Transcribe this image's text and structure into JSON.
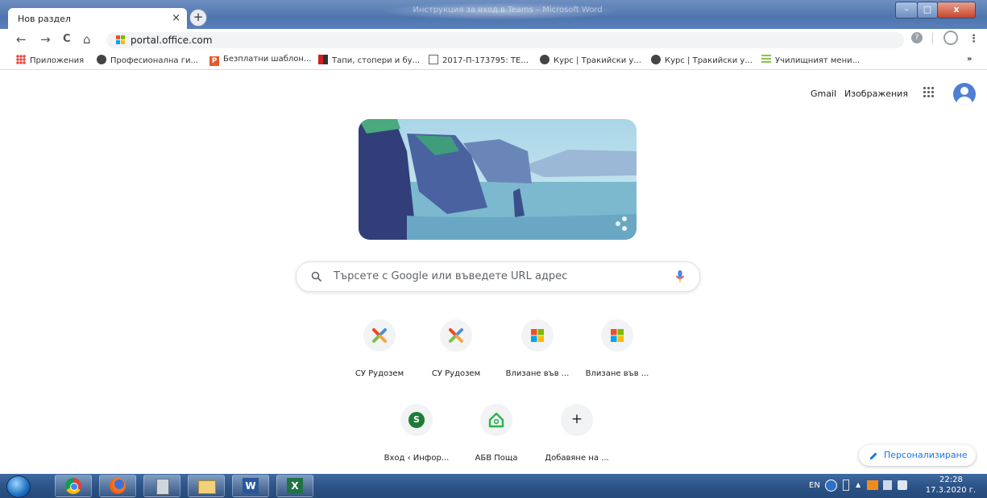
{
  "window": {
    "title": "Инструкция за вход в Teams – Microsoft Word"
  },
  "tab": {
    "title": "Нов раздел",
    "close_glyph": "×",
    "new_tab_glyph": "+"
  },
  "window_controls": {
    "minimize": "–",
    "maximize": "□",
    "close": "x"
  },
  "toolbar": {
    "back_glyph": "←",
    "forward_glyph": "→",
    "reload_glyph": "C",
    "home_glyph": "⌂",
    "url": "portal.office.com",
    "menu_glyph": "⋮"
  },
  "bookmarks": [
    {
      "label": "Приложения",
      "icon": "apps-icon"
    },
    {
      "label": "Професионална ги...",
      "icon": "globe-icon"
    },
    {
      "label": "Безплатни шаблон...",
      "icon": "p-icon"
    },
    {
      "label": "Тапи, стопери и бу...",
      "icon": "bar-icon"
    },
    {
      "label": "2017-П-173795: ТЕ...",
      "icon": "doc-icon"
    },
    {
      "label": "Курс | Тракийски у...",
      "icon": "globe-icon"
    },
    {
      "label": "Курс | Тракийски у...",
      "icon": "globe-icon"
    },
    {
      "label": "Училищният мени...",
      "icon": "lines-icon"
    }
  ],
  "bookmarks_more": "»",
  "top_links": {
    "gmail": "Gmail",
    "images": "Изображения"
  },
  "search": {
    "placeholder": "Търсете с Google или въведете URL адрес"
  },
  "shortcuts_row1": [
    {
      "label": "СУ Рудозем",
      "icon": "joomla-icon"
    },
    {
      "label": "СУ Рудозем",
      "icon": "joomla-icon"
    },
    {
      "label": "Влизане във ...",
      "icon": "microsoft-icon"
    },
    {
      "label": "Влизане във ...",
      "icon": "microsoft-icon"
    }
  ],
  "shortcuts_row2": [
    {
      "label": "Вход ‹ Инфор...",
      "icon": "s-icon",
      "letter": "S"
    },
    {
      "label": "АБВ Поща",
      "icon": "abv-house-icon"
    },
    {
      "label": "Добавяне на ...",
      "icon": "plus-icon",
      "glyph": "+"
    }
  ],
  "customize": {
    "label": "Персонализиране"
  },
  "taskbar": {
    "apps": [
      "chrome-icon",
      "firefox-icon",
      "calculator-icon",
      "explorer-icon",
      "word-icon",
      "excel-icon"
    ],
    "lang": "EN",
    "time": "22:28",
    "date": "17.3.2020 г."
  },
  "colors": {
    "accent": "#1a73e8",
    "taskbar": "#2d5487",
    "titlebar": "#5a80b9"
  }
}
